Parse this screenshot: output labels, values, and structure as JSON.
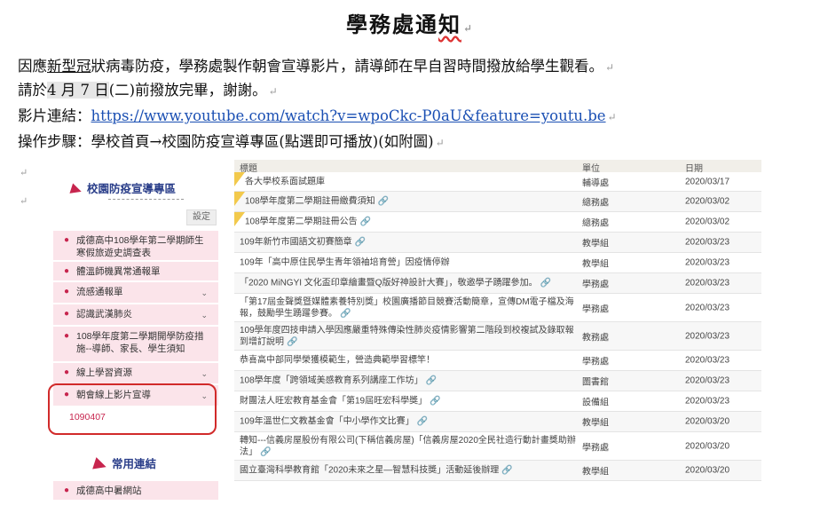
{
  "doc": {
    "title_part1": "學務處通",
    "title_part2": "知",
    "line1_a": "因應",
    "line1_b": "新型冠",
    "line1_c": "狀病毒防疫，學務處製作朝會宣導影片，請導師在早自習時間撥放給學生觀看。",
    "line2_a": "請於",
    "line2_b": "4 月 7 日",
    "line2_c": "(二)前撥放完畢，謝謝。",
    "line3_label": "影片連結：",
    "line3_url": "https://www.youtube.com/watch?v=wpoCkc-P0aU&feature=youtu.be",
    "line4": "操作步驟：學校首頁→校園防疫宣導專區(點選即可播放)(如附圖)",
    "para_mark": "↵"
  },
  "sidebar": {
    "header": "校園防疫宣導專區",
    "settings_label": "設定",
    "items": [
      {
        "label": "成德高中108學年第二學期師生寒假旅遊史調查表",
        "chevron": ""
      },
      {
        "label": "體溫師機異常通報單",
        "chevron": ""
      },
      {
        "label": "流感通報單",
        "chevron": "⌄"
      },
      {
        "label": "認識武漢肺炎",
        "chevron": "⌄"
      },
      {
        "label": "108學年度第二學期開學防疫措施--導師、家長、學生須知",
        "chevron": ""
      },
      {
        "label": "線上學習資源",
        "chevron": "⌄"
      },
      {
        "label": "朝會線上影片宣導",
        "chevron": "⌄"
      },
      {
        "label": "成德高中暑網站",
        "chevron": ""
      }
    ],
    "subitem": "1090407",
    "header2": "常用連結"
  },
  "table": {
    "headers": {
      "title": "標題",
      "unit": "單位",
      "date": "日期"
    },
    "rows": [
      {
        "title": "各大學校系面試題庫",
        "unit": "輔導處",
        "date": "2020/03/17",
        "pin": true,
        "att": ""
      },
      {
        "title": "108學年度第二學期註冊繳費須知",
        "unit": "總務處",
        "date": "2020/03/02",
        "pin": true,
        "att": "🔗"
      },
      {
        "title": "108學年度第二學期註冊公告",
        "unit": "總務處",
        "date": "2020/03/02",
        "pin": true,
        "att": "🔗"
      },
      {
        "title": "109年新竹市國語文初賽簡章",
        "unit": "教學組",
        "date": "2020/03/23",
        "pin": false,
        "att": "🔗"
      },
      {
        "title": "109年「高中原住民學生青年領袖培育營」因疫情停辦",
        "unit": "教學組",
        "date": "2020/03/23",
        "pin": false,
        "att": ""
      },
      {
        "title": "「2020 MiNGYI 文化盃印章繪畫暨Q版好神設計大賽」，敬邀學子踴躍參加。",
        "unit": "學務處",
        "date": "2020/03/23",
        "pin": false,
        "att": "🔗"
      },
      {
        "title": "「第17屆金聲獎暨媒體素養特別獎」校園廣播節目競賽活動簡章，宣傳DM電子檔及海報，鼓勵學生踴躍參賽。",
        "unit": "學務處",
        "date": "2020/03/23",
        "pin": false,
        "att": "🔗"
      },
      {
        "title": "109學年度四技申請入學因應嚴重特殊傳染性肺炎疫情影響第二階段到校複試及錄取報到增訂說明",
        "unit": "教務處",
        "date": "2020/03/23",
        "pin": false,
        "att": "🔗"
      },
      {
        "title": "恭喜高中部同學榮獲模範生，營造典範學習標竿！",
        "unit": "學務處",
        "date": "2020/03/23",
        "pin": false,
        "att": ""
      },
      {
        "title": "108學年度「跨領域美感教育系列講座工作坊」",
        "unit": "圖書館",
        "date": "2020/03/23",
        "pin": false,
        "att": "🔗"
      },
      {
        "title": "財團法人旺宏教育基金會「第19屆旺宏科學獎」",
        "unit": "設備組",
        "date": "2020/03/23",
        "pin": false,
        "att": "🔗"
      },
      {
        "title": "109年溫世仁文教基金會「中小學作文比賽」",
        "unit": "教學組",
        "date": "2020/03/20",
        "pin": false,
        "att": "🔗"
      },
      {
        "title": "轉知---信義房屋股份有限公司(下稱信義房屋)「信義房屋2020全民社造行動計畫獎助辦法」",
        "unit": "學務處",
        "date": "2020/03/20",
        "pin": false,
        "att": "🔗"
      },
      {
        "title": "國立臺灣科學教育館「2020未來之星—智慧科技獎」活動延後辦理",
        "unit": "教學組",
        "date": "2020/03/20",
        "pin": false,
        "att": "🔗"
      }
    ]
  }
}
